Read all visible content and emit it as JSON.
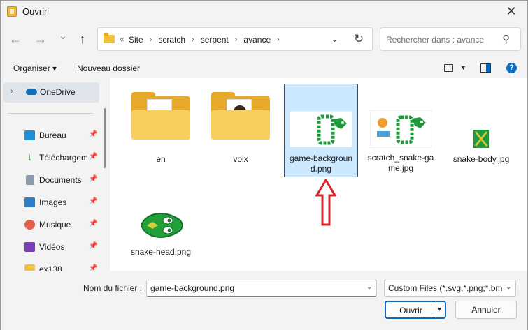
{
  "window": {
    "title": "Ouvrir",
    "close_glyph": "✕"
  },
  "nav": {
    "back_glyph": "←",
    "forward_glyph": "→",
    "recent_glyph": "⌄",
    "up_glyph": "↑"
  },
  "address": {
    "prefix": "«",
    "crumbs": [
      "Site",
      "scratch",
      "serpent",
      "avance"
    ],
    "separator": "›",
    "dropdown_glyph": "⌄",
    "refresh_glyph": "↻"
  },
  "search": {
    "placeholder": "Rechercher dans : avance",
    "icon_glyph": "⚲"
  },
  "toolbar": {
    "organize_label": "Organiser ▾",
    "new_folder_label": "Nouveau dossier",
    "view_caret": "▼",
    "help_glyph": "?"
  },
  "sidebar": {
    "onedrive": {
      "chevron": "›",
      "label": "OneDrive"
    },
    "pin_glyph": "📌",
    "items": [
      {
        "label": "Bureau",
        "icon": "desktop-icon",
        "color": "#1e90d6"
      },
      {
        "label": "Téléchargements",
        "icon": "download-icon",
        "color": "#2a9d3c"
      },
      {
        "label": "Documents",
        "icon": "documents-icon",
        "color": "#8a9aaa"
      },
      {
        "label": "Images",
        "icon": "images-icon",
        "color": "#2d7fc9"
      },
      {
        "label": "Musique",
        "icon": "music-icon",
        "color": "#e0604a"
      },
      {
        "label": "Vidéos",
        "icon": "videos-icon",
        "color": "#7a3fb8"
      },
      {
        "label": "ex138",
        "icon": "folder-icon",
        "color": "#f2c23e"
      }
    ]
  },
  "files": [
    {
      "name": "en",
      "type": "folder"
    },
    {
      "name": "voix",
      "type": "folder"
    },
    {
      "name": "game-background.png",
      "type": "image",
      "selected": true
    },
    {
      "name": "scratch_snake-game.jpg",
      "type": "image"
    },
    {
      "name": "snake-body.jpg",
      "type": "image"
    },
    {
      "name": "snake-head.png",
      "type": "image"
    }
  ],
  "bottom": {
    "filename_label": "Nom du fichier :",
    "filename_value": "game-background.png",
    "filter_value": "Custom Files (*.svg;*.png;*.bmp;",
    "caret_glyph": "⌄",
    "open_label": "Ouvrir",
    "open_caret": "▾",
    "cancel_label": "Annuler"
  },
  "colors": {
    "accent": "#0f6cbd",
    "selection": "#cce8ff",
    "annotation_arrow": "#d9262a",
    "snake_green": "#1e9a3a"
  }
}
